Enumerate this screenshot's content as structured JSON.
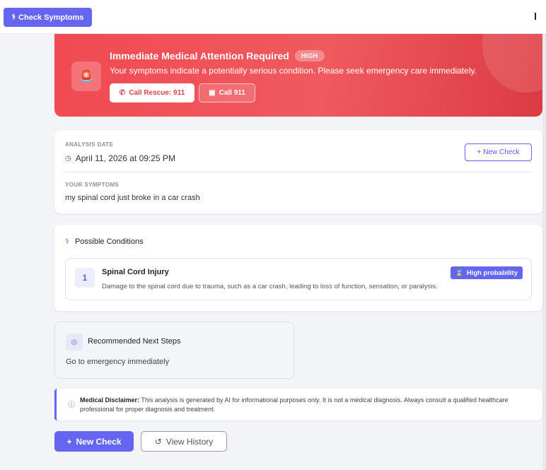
{
  "topbar": {
    "check_symptoms_label": "Check Symptoms",
    "check_symptoms_icon": "stethoscope-icon"
  },
  "alert": {
    "title": "Immediate Medical Attention Required",
    "severity": "HIGH",
    "message": "Your symptoms indicate a potentially serious condition. Please seek emergency care immediately.",
    "rescue_label": "Call Rescue: 911",
    "call_label": "Call 911",
    "icon": "siren-icon",
    "color": "#f04a52"
  },
  "analysis": {
    "date_label": "ANALYSIS DATE",
    "date_value": "April 11, 2026 at 09:25 PM",
    "new_check_label": "+ New Check",
    "symptoms_label": "YOUR SYMPTOMS",
    "symptoms_value": "my spinal cord just broke in a car crash"
  },
  "conditions": {
    "heading": "Possible Conditions",
    "items": [
      {
        "number": "1",
        "name": "Spinal Cord Injury",
        "description": "Damage to the spinal cord due to trauma, such as a car crash, leading to loss of function, sensation, or paralysis.",
        "probability": "High probability"
      }
    ]
  },
  "next_steps": {
    "heading": "Recommended Next Steps",
    "text": "Go to emergency immediately"
  },
  "disclaimer": {
    "label": "Medical Disclaimer:",
    "text": "This analysis is generated by AI for informational purposes only. It is not a medical diagnosis. Always consult a qualified healthcare professional for proper diagnosis and treatment."
  },
  "actions": {
    "new_check_label": "New Check",
    "view_history_label": "View History"
  },
  "colors": {
    "accent": "#6466f1",
    "alert": "#f04a52"
  }
}
